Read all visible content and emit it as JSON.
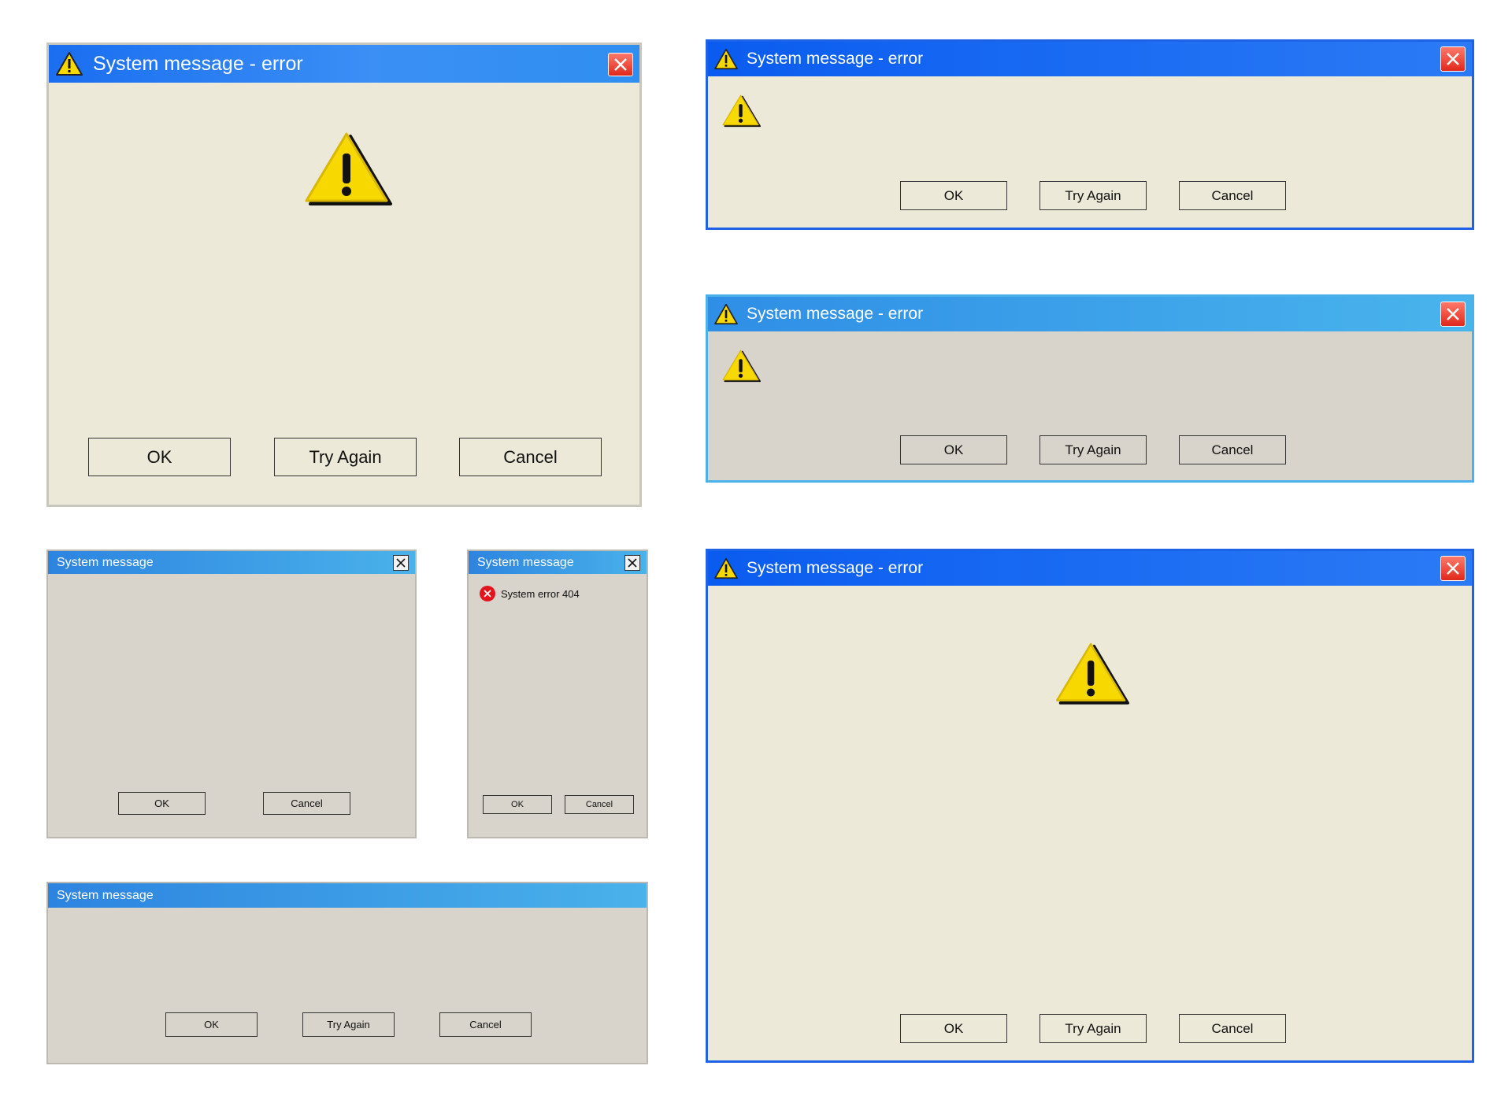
{
  "colors": {
    "dialog_cream": "#ece9d8",
    "dialog_gray": "#d8d3cb",
    "title_blue": "#0a5cf0",
    "title_light_blue": "#49b4ec",
    "close_red": "#e0281b",
    "warning_yellow": "#f7d800",
    "error_red": "#e4141c"
  },
  "icons": {
    "warning": "warning-triangle-icon",
    "close": "close-x-icon",
    "error": "error-circle-x-icon"
  },
  "dialogs": {
    "large_warning": {
      "title": "System message - error",
      "buttons": {
        "ok": "OK",
        "try_again": "Try Again",
        "cancel": "Cancel"
      }
    },
    "compact_blue": {
      "title": "System message - error",
      "buttons": {
        "ok": "OK",
        "try_again": "Try Again",
        "cancel": "Cancel"
      }
    },
    "compact_light_blue": {
      "title": "System message - error",
      "buttons": {
        "ok": "OK",
        "try_again": "Try Again",
        "cancel": "Cancel"
      }
    },
    "gray_medium": {
      "title": "System message",
      "buttons": {
        "ok": "OK",
        "cancel": "Cancel"
      }
    },
    "gray_narrow": {
      "title": "System message",
      "message": "System error 404",
      "buttons": {
        "ok": "OK",
        "cancel": "Cancel"
      }
    },
    "gray_wide": {
      "title": "System message",
      "buttons": {
        "ok": "OK",
        "try_again": "Try Again",
        "cancel": "Cancel"
      }
    },
    "tall_blue": {
      "title": "System message - error",
      "buttons": {
        "ok": "OK",
        "try_again": "Try Again",
        "cancel": "Cancel"
      }
    }
  }
}
